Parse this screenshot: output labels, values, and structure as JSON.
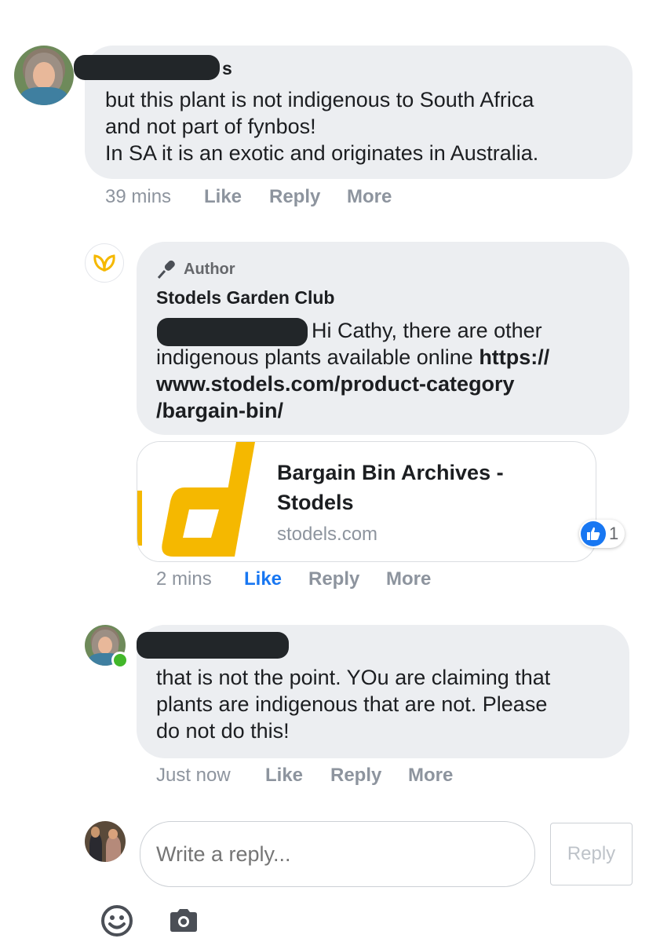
{
  "comment1": {
    "name_suffix": "s",
    "text_lines": [
      "but this plant is not indigenous to South Africa",
      "and not part of fynbos!",
      "In SA it is an exotic and originates in Australia."
    ],
    "time": "39 mins",
    "like": "Like",
    "reply": "Reply",
    "more": "More"
  },
  "comment2": {
    "badge": "Author",
    "name": "Stodels Garden Club",
    "text_after_mention": "Hi Cathy, there are other",
    "text_line2_plain": "indigenous plants available online ",
    "text_line2_bold": "https://",
    "text_line3": "www.stodels.com/product-category",
    "text_line4": "/bargain-bin/",
    "link": {
      "title_line1": "Bargain Bin Archives -",
      "title_line2": "Stodels",
      "domain": "stodels.com"
    },
    "reaction_count": "1",
    "time": "2 mins",
    "like": "Like",
    "reply": "Reply",
    "more": "More",
    "accent": "#1877f2"
  },
  "comment3": {
    "text_lines": [
      "that is not the point. YOu are claiming that",
      "plants are indigenous that are not. Please",
      "do not do this!"
    ],
    "time": "Just now",
    "like": "Like",
    "reply": "Reply",
    "more": "More"
  },
  "composer": {
    "placeholder": "Write a reply...",
    "reply_button": "Reply",
    "icons": [
      "smiley-icon",
      "camera-icon"
    ]
  }
}
